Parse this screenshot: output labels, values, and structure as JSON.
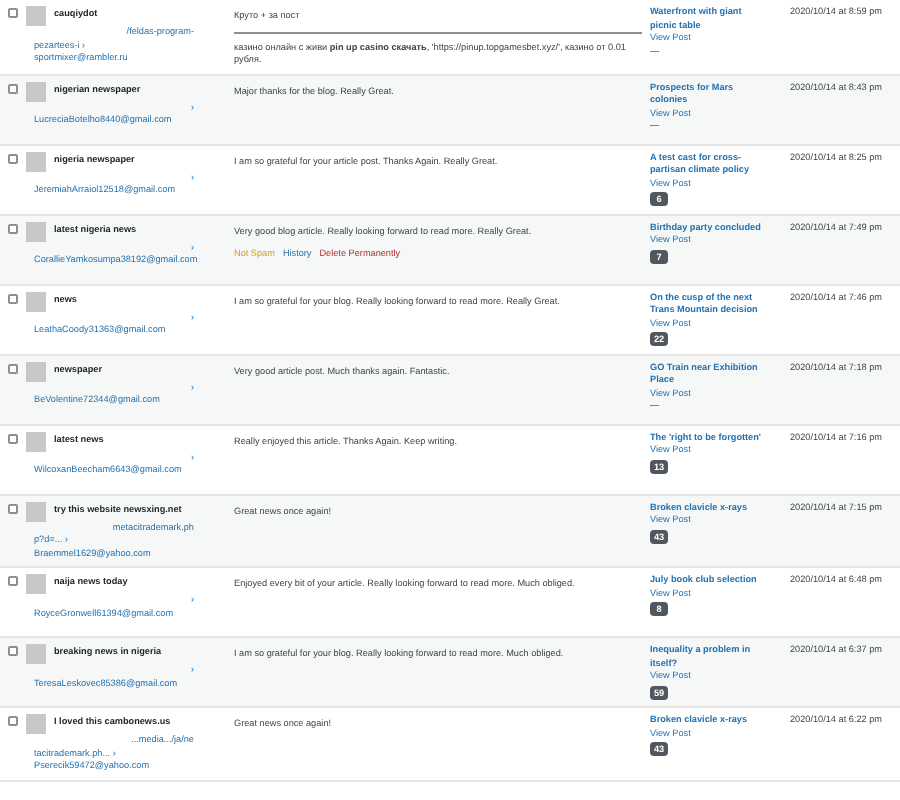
{
  "comments": [
    {
      "author": "cauqiydot",
      "url_lines": [
        "/feldas-program-",
        "pezartees-i ›"
      ],
      "email": "sportmixer@rambler.ru",
      "text": [
        "Круто + за пост",
        "казино онлайн с живи **pin up casino скачать**, 'https://pinup.topgamesbet.xyz/', казино от 0.01 рубля."
      ],
      "post": "Waterfront with giant picnic table",
      "view": "View Post",
      "count": "—",
      "date": "2020/10/14 at 8:59 pm",
      "checked": false
    },
    {
      "author": "nigerian newspaper",
      "url_lines": [
        "›"
      ],
      "email": "LucreciaBotelho8440@gmail.com",
      "text": [
        "Major thanks for the blog. Really Great."
      ],
      "post": "Prospects for Mars colonies",
      "view": "View Post",
      "count": "—",
      "date": "2020/10/14 at 8:43 pm",
      "checked": false
    },
    {
      "author": "nigeria newspaper",
      "url_lines": [
        "›"
      ],
      "email": "JeremiahArraiol12518@gmail.com",
      "text": [
        "I am so grateful for your article post. Thanks Again. Really Great."
      ],
      "post": "A test cast for cross-partisan climate policy",
      "view": "View Post",
      "count": "6",
      "date": "2020/10/14 at 8:25 pm",
      "checked": false
    },
    {
      "author": "latest nigeria news",
      "url_lines": [
        "›"
      ],
      "email": "CorallieYamkosumpa38192@gmail.com",
      "text": [
        "Very good blog article. Really looking forward to read more. Really Great."
      ],
      "actions": [
        {
          "label": "Not Spam",
          "kind": "approve"
        },
        {
          "label": "History",
          "kind": "history"
        },
        {
          "label": "Delete Permanently",
          "kind": "delete"
        }
      ],
      "post": "Birthday party concluded",
      "view": "View Post",
      "count": "7",
      "date": "2020/10/14 at 7:49 pm",
      "checked": false
    },
    {
      "author": "news",
      "url_lines": [
        "›"
      ],
      "email": "LeathaCoody31363@gmail.com",
      "text": [
        "I am so grateful for your blog. Really looking forward to read more. Really Great."
      ],
      "post": "On the cusp of the next Trans Mountain decision",
      "view": "View Post",
      "count": "22",
      "date": "2020/10/14 at 7:46 pm",
      "checked": false
    },
    {
      "author": "newspaper",
      "url_lines": [
        "›"
      ],
      "email": "BeVolentine72344@gmail.com",
      "text": [
        "Very good article post. Much thanks again. Fantastic."
      ],
      "post": "GO Train near Exhibition Place",
      "view": "View Post",
      "count": "—",
      "date": "2020/10/14 at 7:18 pm",
      "checked": false
    },
    {
      "author": "latest news",
      "url_lines": [
        "›"
      ],
      "email": "WilcoxanBeecham6643@gmail.com",
      "text": [
        "Really enjoyed this article. Thanks Again. Keep writing."
      ],
      "post": "The 'right to be forgotten'",
      "view": "View Post",
      "count": "13",
      "date": "2020/10/14 at 7:16 pm",
      "checked": false
    },
    {
      "author": "try this website newsxing.net",
      "url_lines": [
        "metacitrademark.ph",
        "p?d=... ›"
      ],
      "email": "Braemmel1629@yahoo.com",
      "text": [
        "Great news once again!"
      ],
      "post": "Broken clavicle x-rays",
      "view": "View Post",
      "count": "43",
      "date": "2020/10/14 at 7:15 pm",
      "checked": false
    },
    {
      "author": "naija news today",
      "url_lines": [
        "›"
      ],
      "email": "RoyceGronwell61394@gmail.com",
      "text": [
        "Enjoyed every bit of your article. Really looking forward to read more. Much obliged."
      ],
      "post": "July book club selection",
      "view": "View Post",
      "count": "8",
      "date": "2020/10/14 at 6:48 pm",
      "checked": false
    },
    {
      "author": "breaking news in nigeria",
      "url_lines": [
        "›"
      ],
      "email": "TeresaLeskovec85386@gmail.com",
      "text": [
        "I am so grateful for your blog. Really looking forward to read more. Much obliged."
      ],
      "post": "Inequality a problem in itself?",
      "view": "View Post",
      "count": "59",
      "date": "2020/10/14 at 6:37 pm",
      "checked": false
    },
    {
      "author": "I loved this cambonews.us",
      "url_lines": [
        "...media.../ja/ne",
        "tacitrademark.ph... ›"
      ],
      "email": "Pserecik59472@yahoo.com",
      "text": [
        "Great news once again!"
      ],
      "post": "Broken clavicle x-rays",
      "view": "View Post",
      "count": "43",
      "date": "2020/10/14 at 6:22 pm",
      "checked": false
    }
  ]
}
